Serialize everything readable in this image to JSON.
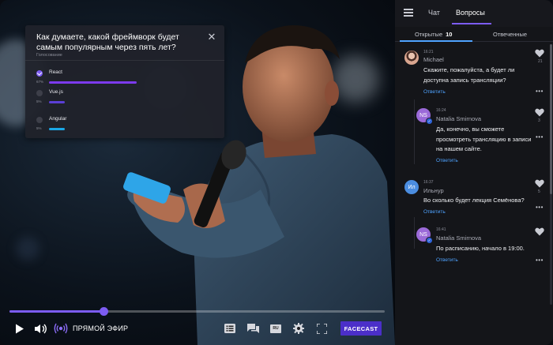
{
  "poll": {
    "question": "Как думаете, какой фреймворк будет самым популярным через пять лет?",
    "subtitle": "Голосование",
    "options": [
      {
        "label": "React",
        "percent": "67%",
        "share": 0.67,
        "selected": true,
        "bar_color": "#7c3aed"
      },
      {
        "label": "Vue.js",
        "percent": "5%",
        "share": 0.12,
        "selected": false,
        "bar_color": "#5b3fd6"
      },
      {
        "label": "Angular",
        "percent": "5%",
        "share": 0.12,
        "selected": false,
        "bar_color": "#1aa7e6"
      }
    ]
  },
  "player": {
    "progress": 0.25,
    "live_label": "ПРЯМОЙ ЭФИР",
    "brand_button": "FACECAST",
    "lang_badge": "RU",
    "icons": [
      "play-icon",
      "volume-icon",
      "live-broadcast-icon",
      "playlist-icon",
      "chat-icon",
      "language-icon",
      "settings-icon",
      "fullscreen-icon"
    ]
  },
  "sidebar": {
    "tabs": [
      "Чат",
      "Вопросы"
    ],
    "active_tab": "Вопросы",
    "subtabs": {
      "open_label": "Открытые",
      "open_count": "10",
      "answered_label": "Отвеченные"
    },
    "accent": "#7c5cf2",
    "link_color": "#4fa3ff"
  },
  "messages": [
    {
      "time": "16:21",
      "name": "Michael",
      "avatar": "photo",
      "text_lines": [
        "Скажите, пожалуйста, а будет ли",
        "доступна запись трансляции?"
      ],
      "reply": "Ответить",
      "likes": "21"
    },
    {
      "time": "16:24",
      "name": "Natalia Smirnova",
      "avatar": "NS",
      "text_lines": [
        "Да, конечно, вы сможете",
        "просмотреть трансляцию в записи",
        "на нашем сайте."
      ],
      "reply": "Ответить",
      "likes": "3"
    },
    {
      "time": "16:37",
      "name": "Ильнур",
      "avatar": "Ил",
      "text_lines": [
        "Во сколько будет лекция Семёнова?"
      ],
      "reply": "Ответить",
      "likes": "5"
    },
    {
      "time": "16:41",
      "name": "Natalia Smirnova",
      "avatar": "NS",
      "text_lines": [
        "По расписанию, начало в 19:00."
      ],
      "reply": "Ответить",
      "likes": ""
    }
  ]
}
